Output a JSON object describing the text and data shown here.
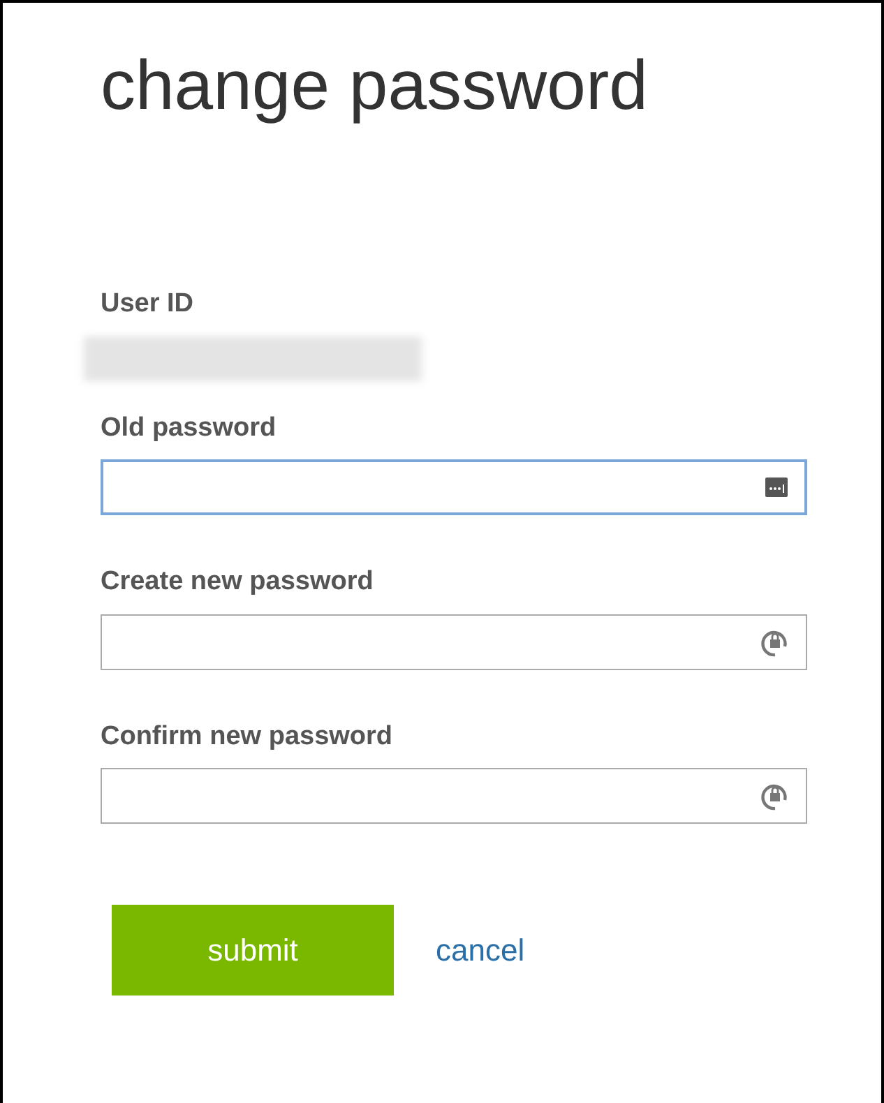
{
  "title": "change password",
  "user_id": {
    "label": "User ID"
  },
  "fields": [
    {
      "label": "Old password",
      "kind": "key",
      "focused": true
    },
    {
      "label": "Create new password",
      "kind": "lock",
      "focused": false
    },
    {
      "label": "Confirm new password",
      "kind": "lock",
      "focused": false
    }
  ],
  "submit": "submit",
  "cancel": "cancel"
}
